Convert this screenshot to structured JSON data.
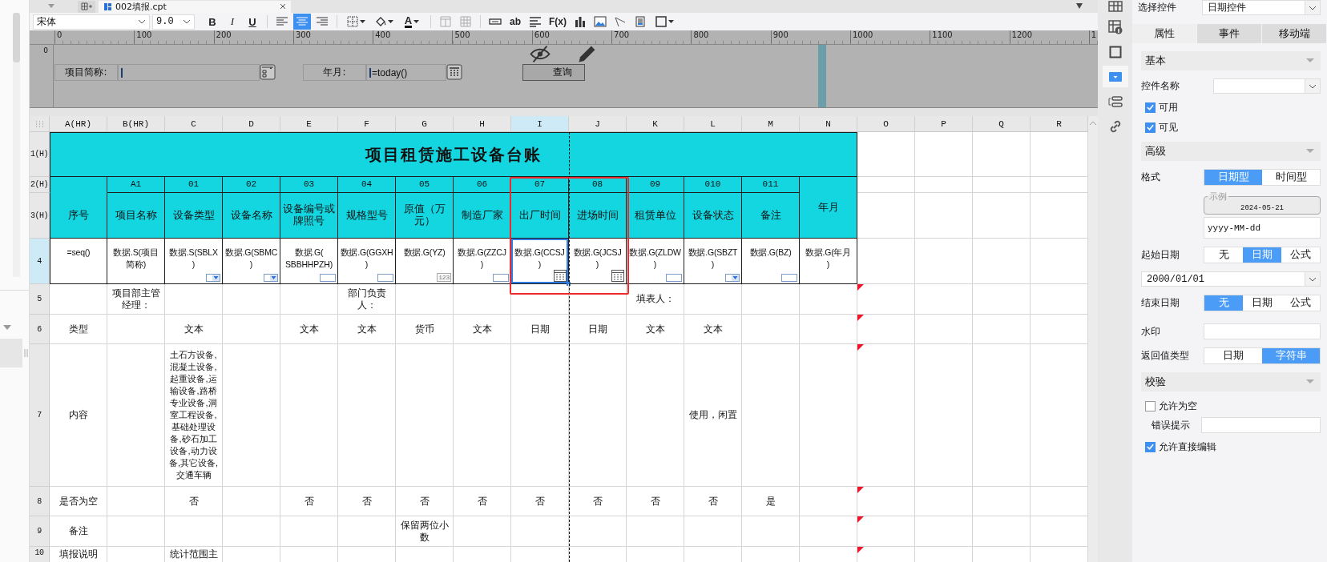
{
  "file_tab": {
    "label": "002填报.cpt"
  },
  "toolbar": {
    "font": "宋体",
    "size": "9.0",
    "tools": [
      {
        "kind": "bold",
        "label": "B"
      },
      {
        "kind": "italic",
        "label": "I"
      },
      {
        "kind": "underline",
        "label": "U"
      },
      {
        "kind": "separator"
      },
      {
        "kind": "align-left",
        "selected": false
      },
      {
        "kind": "align-center",
        "selected": true
      },
      {
        "kind": "align-right",
        "selected": false
      },
      {
        "kind": "separator"
      },
      {
        "kind": "borders"
      },
      {
        "kind": "fill"
      },
      {
        "kind": "font-color",
        "label": "A"
      },
      {
        "kind": "separator"
      },
      {
        "kind": "merge"
      },
      {
        "kind": "grid"
      },
      {
        "kind": "separator"
      },
      {
        "kind": "field"
      },
      {
        "kind": "text-icon",
        "label": "ab"
      },
      {
        "kind": "lines"
      },
      {
        "kind": "text-icon",
        "label": "F(x)"
      },
      {
        "kind": "bar-chart"
      },
      {
        "kind": "image"
      },
      {
        "kind": "slash"
      },
      {
        "kind": "document"
      },
      {
        "kind": "box"
      }
    ]
  },
  "vertical_ruler": {
    "marks": [
      "0"
    ]
  },
  "ruler": {
    "marks": [
      "0",
      "100",
      "200",
      "300",
      "400",
      "500",
      "600",
      "700",
      "800",
      "900",
      "1000",
      "1100",
      "1200",
      "1"
    ]
  },
  "parameters": {
    "fields": [
      {
        "label": "项目简称:",
        "kind": "tree"
      },
      {
        "label": "年月:",
        "kind": "date",
        "value": "=today()"
      }
    ],
    "button": "查询"
  },
  "sheet": {
    "columns": [
      {
        "label": "A(HR)",
        "selected": false
      },
      {
        "label": "B(HR)",
        "selected": false
      },
      {
        "label": "C",
        "selected": false
      },
      {
        "label": "D",
        "selected": false
      },
      {
        "label": "E",
        "selected": false
      },
      {
        "label": "F",
        "selected": false
      },
      {
        "label": "G",
        "selected": false
      },
      {
        "label": "H",
        "selected": false
      },
      {
        "label": "I",
        "selected": true
      },
      {
        "label": "J",
        "selected": false
      },
      {
        "label": "K",
        "selected": false
      },
      {
        "label": "L",
        "selected": false
      },
      {
        "label": "M",
        "selected": false
      },
      {
        "label": "N",
        "selected": false
      },
      {
        "label": "O",
        "selected": false
      },
      {
        "label": "P",
        "selected": false
      },
      {
        "label": "Q",
        "selected": false
      },
      {
        "label": "R",
        "selected": false
      }
    ],
    "title": "项目租赁施工设备台账",
    "codes": [
      "A1",
      "01",
      "02",
      "03",
      "04",
      "05",
      "06",
      "07",
      "08",
      "09",
      "010",
      "011"
    ],
    "headers": [
      "序号",
      "项目名称",
      "设备类型",
      "设备名称",
      "设备编号或牌照号",
      "规格型号",
      "原值（万元）",
      "制造厂家",
      "出厂时间",
      "进场时间",
      "租赁单位",
      "设备状态",
      "备注"
    ],
    "year_header": "年月",
    "bindings": [
      {
        "text": "=seq()",
        "selected": false
      },
      {
        "text": "数据.S(项目简称)",
        "selected": false
      },
      {
        "text": "数据.S(SBLX\n)",
        "selected": false,
        "widget": {
          "kind": "combo"
        }
      },
      {
        "text": "数据.G(SBMC\n)",
        "selected": false,
        "widget": {
          "kind": "combo"
        }
      },
      {
        "text": "数据.G(\nSBBHHPZH)",
        "selected": false,
        "widget": {
          "kind": "textbox"
        }
      },
      {
        "text": "数据.G(GGXH\n)",
        "selected": false,
        "widget": {
          "kind": "textbox"
        }
      },
      {
        "text": "数据.G(YZ)",
        "selected": false,
        "widget": {
          "kind": "number",
          "label": "123"
        }
      },
      {
        "text": "数据.G(ZZCJ\n)",
        "selected": false,
        "widget": {
          "kind": "textbox"
        }
      },
      {
        "text": "数据.G(CCSJ\n)",
        "selected": true,
        "widget": {
          "kind": "date"
        }
      },
      {
        "text": "数据.G(JCSJ\n)",
        "selected": false,
        "widget": {
          "kind": "date"
        }
      },
      {
        "text": "数据.G(ZLDW\n)",
        "selected": false,
        "widget": {
          "kind": "textbox"
        }
      },
      {
        "text": "数据.G(SBZT\n)",
        "selected": false,
        "widget": {
          "kind": "combo"
        }
      },
      {
        "text": "数据.G(BZ)",
        "selected": false,
        "widget": {
          "kind": "textbox"
        }
      },
      {
        "text": "数据.G(年月\n)",
        "selected": false
      }
    ],
    "rows": [
      {
        "label": "1(H)",
        "selected": false,
        "flagged": false
      },
      {
        "label": "2(H)",
        "selected": false,
        "flagged": false
      },
      {
        "label": "3(H)",
        "selected": false,
        "flagged": false
      },
      {
        "label": "4",
        "selected": true,
        "flagged": false
      },
      {
        "label": "5",
        "selected": false,
        "flagged": true,
        "cells": {
          "B": "项目部主管经理：",
          "F": "部门负责人：",
          "K": "填表人："
        }
      },
      {
        "label": "6",
        "selected": false,
        "flagged": true,
        "cells": {
          "A": "类型",
          "C": "文本",
          "E": "文本",
          "F": "文本",
          "G": "货币",
          "H": "文本",
          "I": "日期",
          "J": "日期",
          "K": "文本",
          "L": "文本"
        }
      },
      {
        "label": "7",
        "selected": false,
        "flagged": true,
        "cells": {
          "A": "内容",
          "C": "土石方设备,混凝土设备,起重设备,运输设备,路桥专业设备,洞室工程设备,基础处理设备,砂石加工设备,动力设备,其它设备,交通车辆",
          "L": "使用，闲置"
        }
      },
      {
        "label": "8",
        "selected": false,
        "flagged": true,
        "cells": {
          "A": "是否为空",
          "C": "否",
          "E": "否",
          "F": "否",
          "G": "否",
          "H": "否",
          "I": "否",
          "J": "否",
          "K": "否",
          "L": "否",
          "M": "是"
        }
      },
      {
        "label": "9",
        "selected": false,
        "flagged": true,
        "cells": {
          "A": "备注",
          "G": "保留两位小数"
        }
      },
      {
        "label": "10",
        "selected": false,
        "flagged": true,
        "cells": {
          "A": "填报说明",
          "C": "统计范围主"
        }
      }
    ],
    "annotation": {
      "kind": "box"
    }
  },
  "side_icons": [
    {
      "kind": "grid",
      "selected": false
    },
    {
      "kind": "cell-info",
      "selected": false
    },
    {
      "kind": "frame",
      "selected": false
    },
    {
      "kind": "widget",
      "selected": true
    },
    {
      "kind": "layout",
      "selected": false
    },
    {
      "kind": "link",
      "selected": false
    }
  ],
  "panel": {
    "select_label": "选择控件",
    "select_value": "日期控件",
    "tabs": [
      {
        "label": "属性",
        "selected": true
      },
      {
        "label": "事件",
        "selected": false
      },
      {
        "label": "移动端",
        "selected": false
      }
    ],
    "sections": [
      {
        "title": "基本",
        "rows": [
          {
            "kind": "select",
            "label": "控件名称"
          },
          {
            "kind": "checkbox",
            "label": "可用",
            "checked": true
          },
          {
            "kind": "checkbox",
            "label": "可见",
            "checked": true
          }
        ]
      },
      {
        "title": "高级",
        "rows": [
          {
            "kind": "segmented",
            "label": "格式",
            "options": [
              {
                "label": "日期型",
                "selected": true
              },
              {
                "label": "时间型",
                "selected": false
              }
            ]
          },
          {
            "kind": "sample",
            "legend": "示例",
            "value": "2024-05-21"
          },
          {
            "kind": "input",
            "value": "yyyy-MM-dd"
          },
          {
            "kind": "segmented",
            "label": "起始日期",
            "options": [
              {
                "label": "无",
                "selected": false
              },
              {
                "label": "日期",
                "selected": true
              },
              {
                "label": "公式",
                "selected": false
              }
            ]
          },
          {
            "kind": "select",
            "value": "2000/01/01"
          },
          {
            "kind": "segmented",
            "label": "结束日期",
            "options": [
              {
                "label": "无",
                "selected": true
              },
              {
                "label": "日期",
                "selected": false
              },
              {
                "label": "公式",
                "selected": false
              }
            ]
          },
          {
            "kind": "input",
            "label": "水印"
          },
          {
            "kind": "segmented",
            "label": "返回值类型",
            "options": [
              {
                "label": "日期",
                "selected": false
              },
              {
                "label": "字符串",
                "selected": true
              }
            ]
          }
        ]
      },
      {
        "title": "校验",
        "rows": [
          {
            "kind": "checkbox",
            "label": "允许为空",
            "checked": false
          },
          {
            "kind": "sub-input",
            "label": "错误提示"
          },
          {
            "kind": "checkbox",
            "label": "允许直接编辑",
            "checked": true
          }
        ]
      }
    ]
  }
}
